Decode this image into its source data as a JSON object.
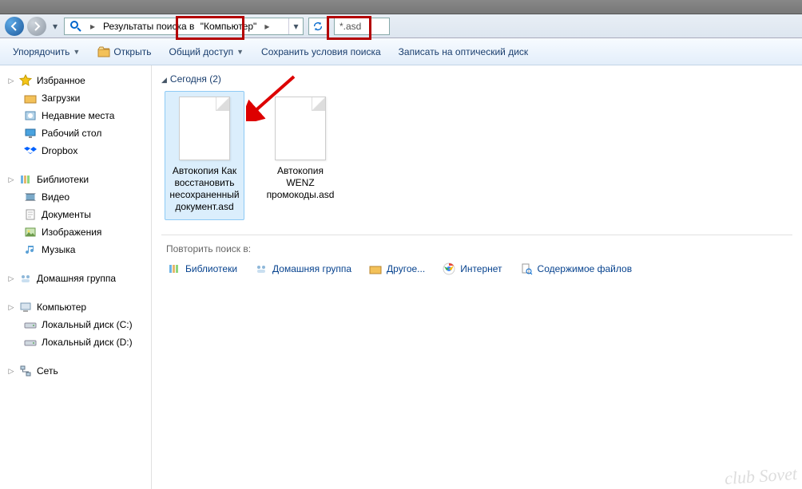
{
  "address": {
    "prefix": "Результаты поиска в",
    "location": "\"Компьютер\"",
    "search_query": "*.asd"
  },
  "toolbar": {
    "organize": "Упорядочить",
    "open": "Открыть",
    "share": "Общий доступ",
    "save_search": "Сохранить условия поиска",
    "burn": "Записать на оптический диск"
  },
  "sidebar": {
    "favorites": {
      "head": "Избранное",
      "items": [
        "Загрузки",
        "Недавние места",
        "Рабочий стол",
        "Dropbox"
      ]
    },
    "libraries": {
      "head": "Библиотеки",
      "items": [
        "Видео",
        "Документы",
        "Изображения",
        "Музыка"
      ]
    },
    "homegroup": {
      "head": "Домашняя группа"
    },
    "computer": {
      "head": "Компьютер",
      "items": [
        "Локальный диск (C:)",
        "Локальный диск (D:)"
      ]
    },
    "network": {
      "head": "Сеть"
    }
  },
  "content": {
    "group_label": "Сегодня (2)",
    "files": [
      {
        "name": "Автокопия Как восстановить несохраненный документ.asd",
        "selected": true
      },
      {
        "name": "Автокопия WENZ промокоды.asd",
        "selected": false
      }
    ],
    "repeat_label": "Повторить поиск в:",
    "repeat_links": [
      "Библиотеки",
      "Домашняя группа",
      "Другое...",
      "Интернет",
      "Содержимое файлов"
    ]
  },
  "watermark": "club\nSovet"
}
